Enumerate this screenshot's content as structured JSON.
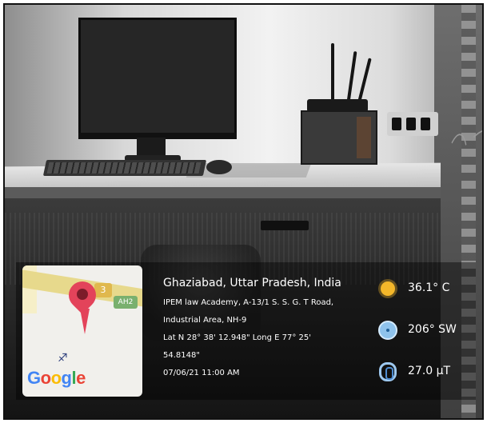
{
  "map": {
    "road_shield": "3",
    "highway_label": "AH2",
    "logo": [
      "G",
      "o",
      "o",
      "g",
      "l",
      "e"
    ]
  },
  "location": {
    "city": "Ghaziabad, Uttar Pradesh, India",
    "address_line1": "IPEM law Academy, A-13/1 S. S. G. T Road,",
    "address_line2": "Industrial Area, NH-9",
    "coordinates_line1": "Lat N 28° 38' 12.948\" Long E 77° 25'",
    "coordinates_line2": "54.8148\"",
    "datetime": "07/06/21 11:00 AM"
  },
  "stats": {
    "temperature": "36.1° C",
    "heading": "206° SW",
    "magnetic": "27.0 μT"
  },
  "icons": {
    "temperature": "sun-icon",
    "heading": "compass-icon",
    "magnetic": "magnet-icon"
  },
  "colors": {
    "pin": "#e3435a",
    "sun": "#f4b72a",
    "compass": "#8fc3ec"
  }
}
